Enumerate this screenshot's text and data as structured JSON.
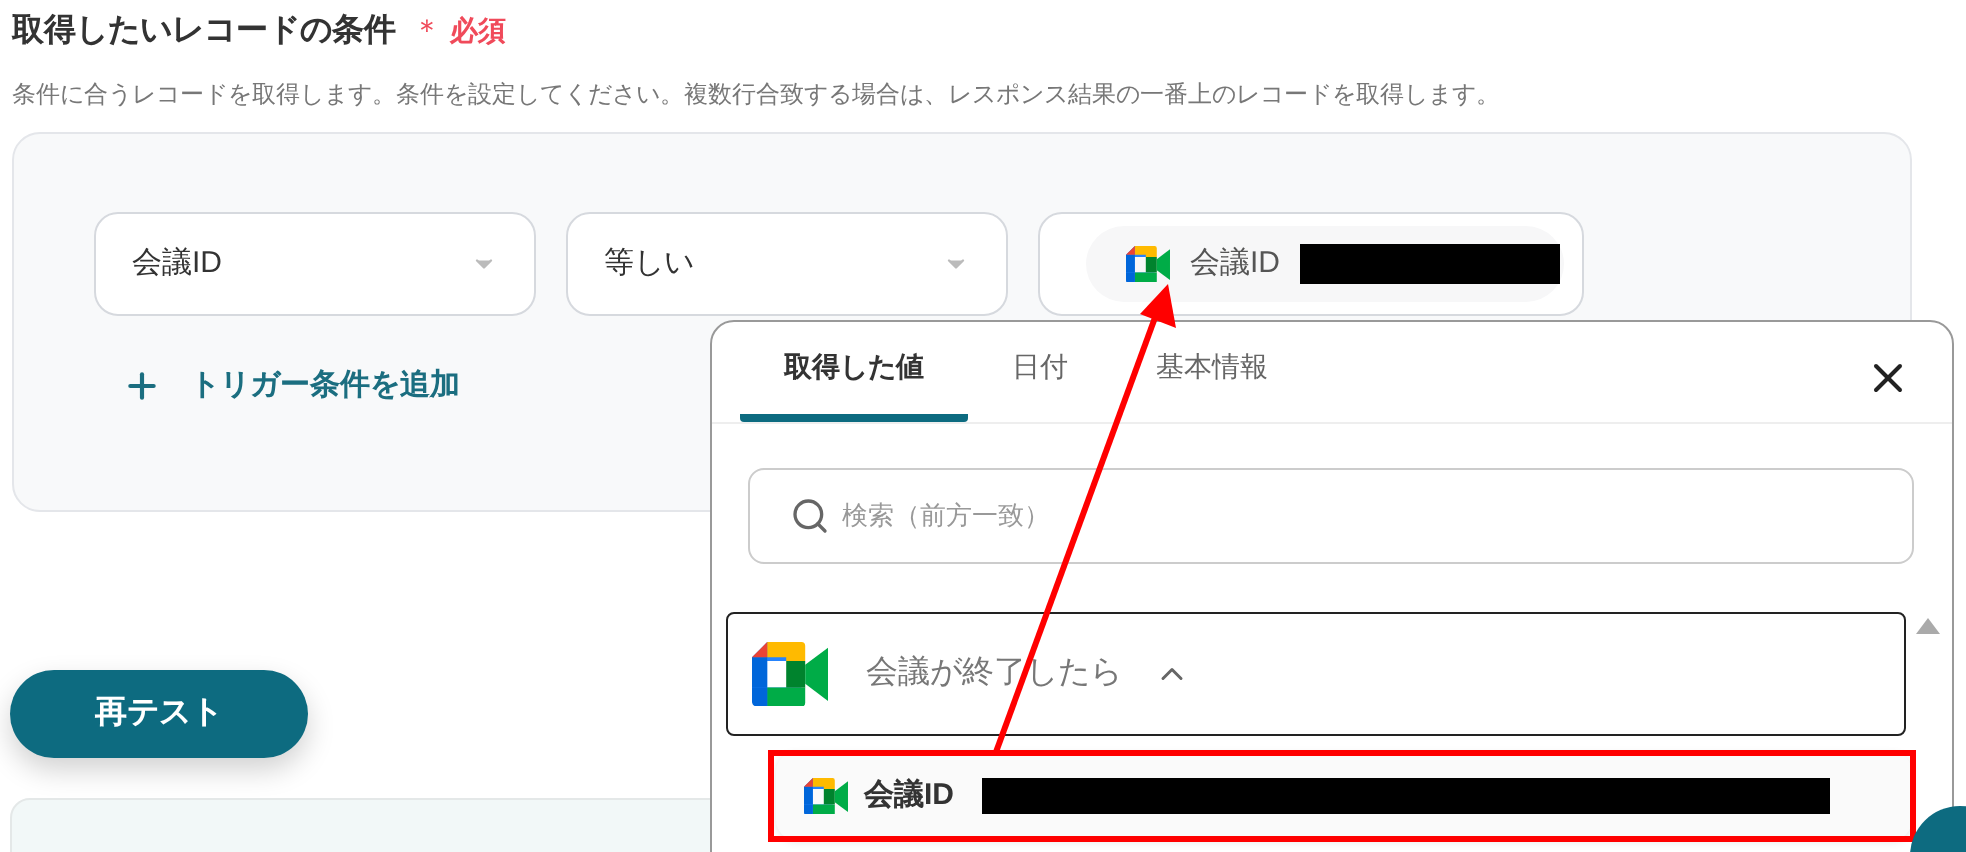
{
  "heading": {
    "title": "取得したいレコードの条件",
    "required_mark": "＊",
    "required_label": "必須"
  },
  "description": "条件に合うレコードを取得します。条件を設定してください。複数行合致する場合は、レスポンス結果の一番上のレコードを取得します。",
  "conditions": [
    {
      "kind": "select",
      "value": "会議ID"
    },
    {
      "kind": "select",
      "value": "等しい"
    },
    {
      "kind": "token",
      "value": "会議ID"
    }
  ],
  "add_condition": "トリガー条件を追加",
  "retest_button": "再テスト",
  "popup": {
    "tabs": [
      {
        "label": "取得した値",
        "selected": true
      },
      {
        "label": "日付",
        "selected": false
      },
      {
        "label": "基本情報",
        "selected": false
      }
    ],
    "search": {
      "placeholder": "検索（前方一致）"
    },
    "group": {
      "title": "会議が終了したら",
      "expanded": true
    },
    "items": [
      {
        "label": "会議ID"
      }
    ]
  }
}
